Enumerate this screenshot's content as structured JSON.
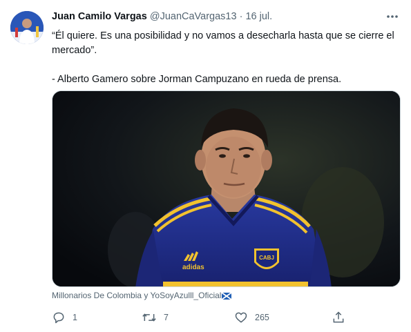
{
  "tweet": {
    "author_name": "Juan Camilo Vargas",
    "handle": "@JuanCaVargas13",
    "separator": "·",
    "date": "16 jul.",
    "text_line1": "“Él quiere. Es una posibilidad y no vamos a desecharla hasta que se cierre el mercado”.",
    "text_line2": "- Alberto Gamero sobre Jorman Campuzano en rueda de prensa.",
    "media_caption": "Millonarios De Colombia y YoSoyAzulll_Oficial",
    "photo_badge_text": "CABJ",
    "photo_sponsor_text": "adidas",
    "replies": "1",
    "retweets": "7",
    "likes": "265"
  },
  "icons": {
    "more": "more-horizontal-icon",
    "reply": "reply-icon",
    "retweet": "retweet-icon",
    "like": "heart-icon",
    "share": "share-icon",
    "flag": "scotland-flag-icon"
  },
  "colors": {
    "text": "#0f1419",
    "secondary": "#536471",
    "jersey_blue": "#1f2d8c",
    "jersey_yellow": "#f2c22e"
  }
}
